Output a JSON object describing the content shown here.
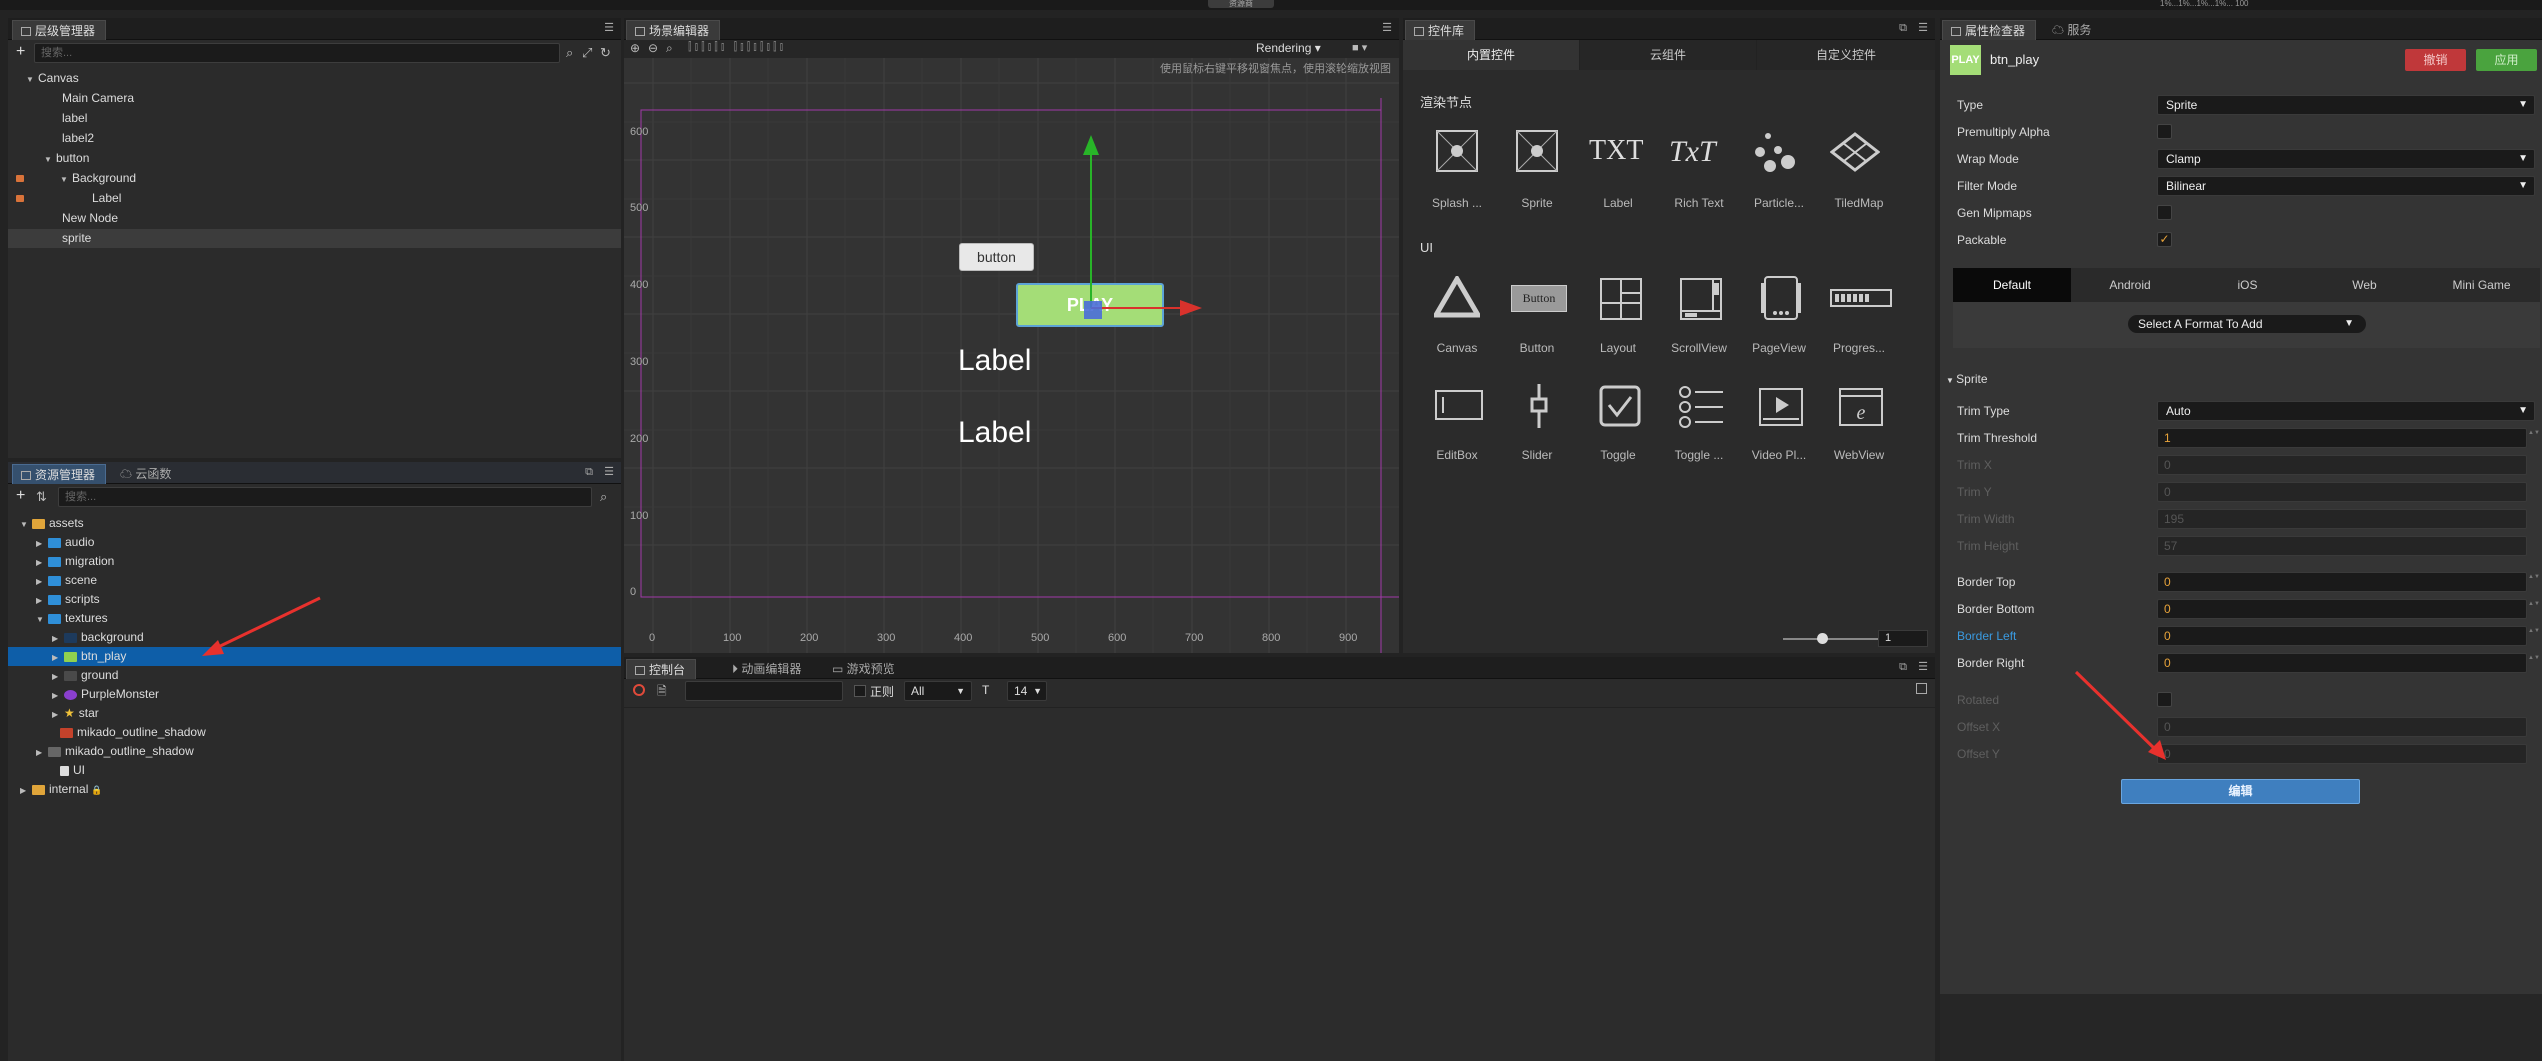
{
  "top": {
    "btn1": "资源商",
    "right_text": "1%...1%...1%...1%... 100"
  },
  "hierarchy": {
    "tab": "层级管理器",
    "search_placeholder": "搜索...",
    "nodes": [
      {
        "label": "Canvas",
        "arrow": "▼"
      },
      {
        "label": "Main Camera"
      },
      {
        "label": "label"
      },
      {
        "label": "label2"
      },
      {
        "label": "button",
        "arrow": "▼"
      },
      {
        "label": "Background",
        "arrow": "▼"
      },
      {
        "label": "Label"
      },
      {
        "label": "New Node"
      },
      {
        "label": "sprite"
      }
    ]
  },
  "assets": {
    "tab1": "资源管理器",
    "tab2": "云函数",
    "search_placeholder": "搜索...",
    "items": [
      {
        "label": "assets"
      },
      {
        "label": "audio"
      },
      {
        "label": "migration"
      },
      {
        "label": "scene"
      },
      {
        "label": "scripts"
      },
      {
        "label": "textures"
      },
      {
        "label": "background"
      },
      {
        "label": "btn_play"
      },
      {
        "label": "ground"
      },
      {
        "label": "PurpleMonster"
      },
      {
        "label": "star"
      },
      {
        "label": "mikado_outline_shadow"
      },
      {
        "label": "mikado_outline_shadow"
      },
      {
        "label": "UI"
      },
      {
        "label": "internal"
      }
    ]
  },
  "scene": {
    "tab": "场景编辑器",
    "rendering": "Rendering",
    "hint": "使用鼠标右键平移视窗焦点，使用滚轮缩放视图",
    "y_ticks": [
      "600",
      "500",
      "400",
      "300",
      "200",
      "100",
      "0"
    ],
    "x_ticks": [
      "0",
      "100",
      "200",
      "300",
      "400",
      "500",
      "600",
      "700",
      "800",
      "900"
    ],
    "button_text": "button",
    "play_text": "PLAY",
    "label1": "Label",
    "label2": "Label"
  },
  "widgets": {
    "tab": "控件库",
    "tabs": [
      "内置控件",
      "云组件",
      "自定义控件"
    ],
    "section1": "渲染节点",
    "section2": "UI",
    "render_items": [
      "Splash ...",
      "Sprite",
      "Label",
      "Rich Text",
      "Particle...",
      "TiledMap"
    ],
    "ui_items": [
      "Canvas",
      "Button",
      "Layout",
      "ScrollView",
      "PageView",
      "Progres...",
      "EditBox",
      "Slider",
      "Toggle",
      "Toggle ...",
      "Video Pl...",
      "WebView"
    ],
    "zoom_value": "1",
    "txt": "TXT",
    "rich": "TxT",
    "btn_inner": "Button"
  },
  "console": {
    "tabs": [
      "控制台",
      "动画编辑器",
      "游戏预览"
    ],
    "regex": "正则",
    "level": "All",
    "font_size": "14"
  },
  "inspector": {
    "tabs": [
      "属性检查器",
      "服务"
    ],
    "asset_name": "btn_play",
    "thumb": "PLAY",
    "revert": "撤销",
    "apply": "应用",
    "props": [
      {
        "label": "Type",
        "value": "Sprite"
      },
      {
        "label": "Premultiply Alpha"
      },
      {
        "label": "Wrap Mode",
        "value": "Clamp"
      },
      {
        "label": "Filter Mode",
        "value": "Bilinear"
      },
      {
        "label": "Gen Mipmaps"
      },
      {
        "label": "Packable"
      }
    ],
    "platform_tabs": [
      "Default",
      "Android",
      "iOS",
      "Web",
      "Mini Game"
    ],
    "format_select": "Select A Format To Add",
    "sprite_section": "Sprite",
    "sprite_props": [
      {
        "label": "Trim Type",
        "value": "Auto"
      },
      {
        "label": "Trim Threshold",
        "value": "1"
      },
      {
        "label": "Trim X",
        "value": "0"
      },
      {
        "label": "Trim Y",
        "value": "0"
      },
      {
        "label": "Trim Width",
        "value": "195"
      },
      {
        "label": "Trim Height",
        "value": "57"
      },
      {
        "label": "Border Top",
        "value": "0"
      },
      {
        "label": "Border Bottom",
        "value": "0"
      },
      {
        "label": "Border Left",
        "value": "0"
      },
      {
        "label": "Border Right",
        "value": "0"
      },
      {
        "label": "Rotated"
      },
      {
        "label": "Offset X",
        "value": "0"
      },
      {
        "label": "Offset Y",
        "value": "0"
      }
    ],
    "edit_button": "编辑"
  }
}
